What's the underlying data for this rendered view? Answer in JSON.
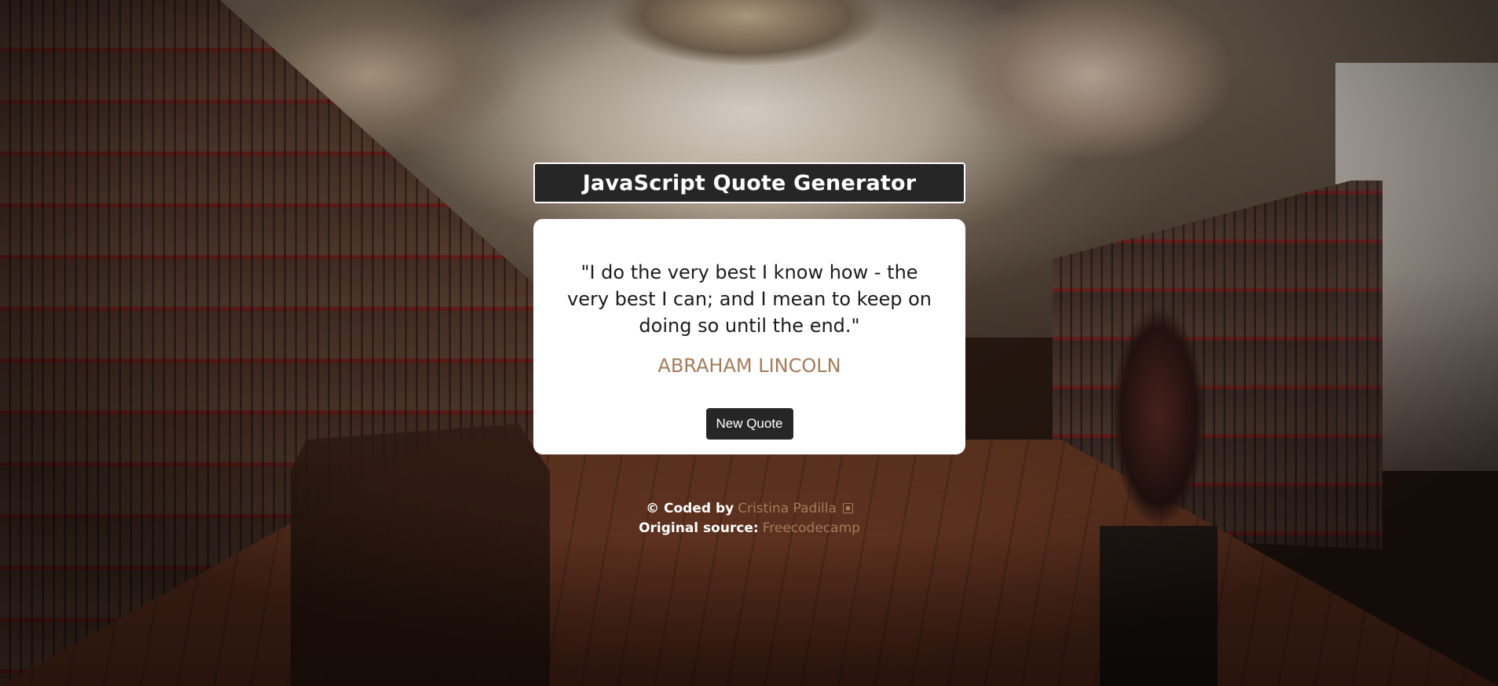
{
  "header": {
    "title": "JavaScript Quote Generator"
  },
  "quote_card": {
    "quote_text": "\"I do the very best I know how - the very best I can; and I mean to keep on doing so until the end.\"",
    "author": "Abraham Lincoln",
    "new_quote_label": "New Quote"
  },
  "footer": {
    "coded_by_label": "© Coded by",
    "coded_by_link": "Cristina Padilla",
    "source_label": "Original source:",
    "source_link": "Freecodecamp",
    "link_icon": "external-link-icon"
  },
  "colors": {
    "accent": "#a27c5c",
    "dark": "#262626",
    "card_bg": "#ffffff"
  }
}
